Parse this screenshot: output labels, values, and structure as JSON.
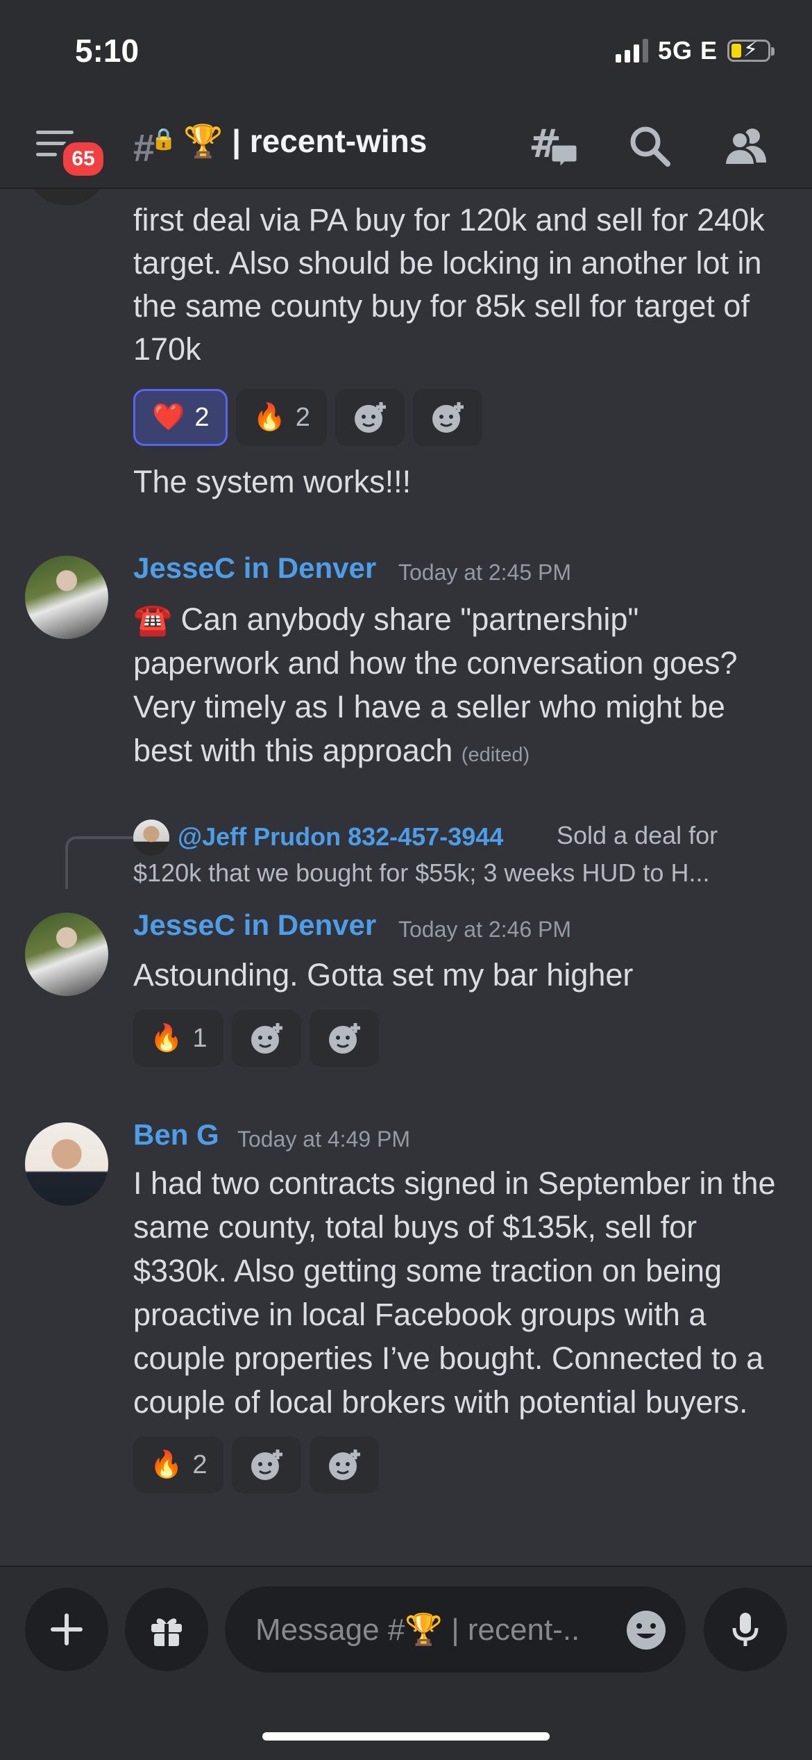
{
  "status": {
    "time": "5:10",
    "network": "5G E"
  },
  "header": {
    "badge_count": "65",
    "channel_emoji": "🏆",
    "channel_name": "| recent-wins",
    "icons": [
      "menu-icon",
      "locked-channel-icon",
      "threads-icon",
      "search-icon",
      "members-icon"
    ]
  },
  "messages": {
    "top_text": "first deal via PA buy for 120k and sell for 240k target. Also should be locking in another lot in the same county buy for 85k sell for target of 170k",
    "top_reactions": [
      {
        "emoji": "❤️",
        "count": "2",
        "active": true
      },
      {
        "emoji": "🔥",
        "count": "2",
        "active": false
      }
    ],
    "followup": "The system works!!!",
    "m1": {
      "author": "JesseC in Denver",
      "timestamp": "Today at 2:45 PM",
      "emoji": "☎️",
      "text": "Can anybody share \"partnership\" paperwork and how the conversation goes? Very timely as I have a seller who might be best with this approach",
      "edited": "(edited)"
    },
    "reply": {
      "mention": "@Jeff Prudon 832-457-3944",
      "text_line1": "Sold a deal for",
      "text_line2": "$120k that we bought for $55k; 3 weeks HUD to H..."
    },
    "m2": {
      "author": "JesseC in Denver",
      "timestamp": "Today at 2:46 PM",
      "text": "Astounding. Gotta set my bar higher",
      "reactions": [
        {
          "emoji": "🔥",
          "count": "1"
        }
      ]
    },
    "m3": {
      "author": "Ben G",
      "timestamp": "Today at 4:49 PM",
      "text": "I had two contracts signed in September in the same county, total buys of $135k, sell for $330k. Also getting some traction on being proactive in local Facebook groups with a couple properties I’ve bought. Connected to a couple of local brokers with potential buyers.",
      "reactions": [
        {
          "emoji": "🔥",
          "count": "2"
        }
      ]
    }
  },
  "composer": {
    "placeholder": "Message #🏆 | recent-..",
    "icons": [
      "plus-icon",
      "gift-icon",
      "emoji-icon",
      "microphone-icon"
    ]
  },
  "colors": {
    "background": "#313338",
    "header": "#2b2d31",
    "link": "#4e9de8",
    "accent": "#5865f2",
    "badge": "#f23f42"
  }
}
